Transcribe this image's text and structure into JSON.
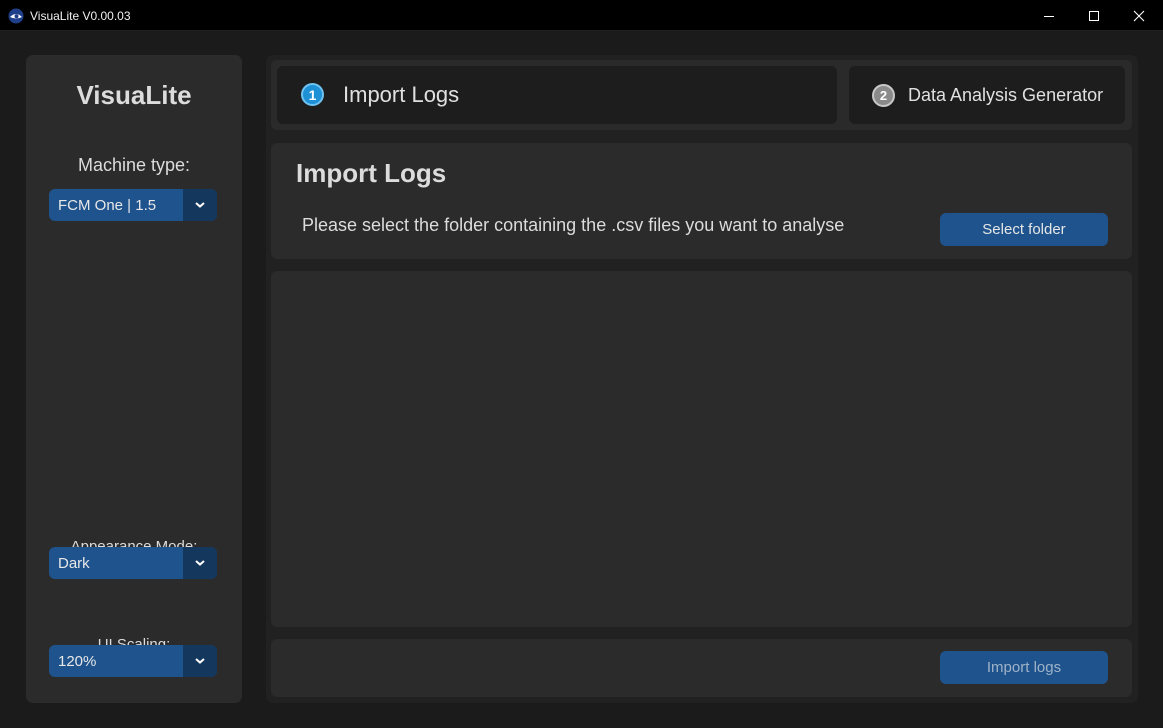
{
  "window": {
    "title": "VisuaLite V0.00.03",
    "icon": "app-eye-icon",
    "controls": [
      "minimize-icon",
      "maximize-icon",
      "close-icon"
    ]
  },
  "sidebar": {
    "logo": "VisuaLite",
    "machine_type": {
      "label": "Machine type:",
      "value": "FCM One | 1.5"
    },
    "appearance_mode": {
      "label": "Appearance Mode:",
      "value": "Dark"
    },
    "ui_scaling": {
      "label": "UI Scaling:",
      "value": "120%"
    }
  },
  "tabs": [
    {
      "number": "1",
      "label": "Import Logs",
      "active": true
    },
    {
      "number": "2",
      "label": "Data Analysis Generator",
      "active": false
    }
  ],
  "import_panel": {
    "title": "Import Logs",
    "instruction": "Please select the folder containing the .csv files you want to analyse",
    "select_button": "Select folder"
  },
  "footer": {
    "import_button": "Import logs"
  },
  "colors": {
    "accent": "#1f538d",
    "accent_dark": "#14375e",
    "active_step": "#1e90d6",
    "inactive_step": "#8a8a8a",
    "panel": "#2b2b2b",
    "background": "#1b1b1b"
  }
}
